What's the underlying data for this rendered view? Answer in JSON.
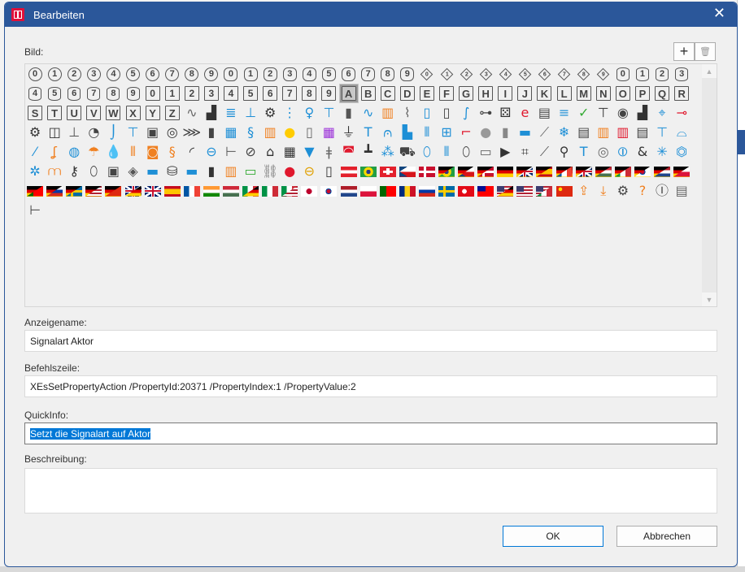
{
  "window": {
    "title": "Bearbeiten",
    "close_glyph": "✕"
  },
  "toolbar": {
    "add_glyph": "+",
    "delete_glyph": "🗑"
  },
  "picker": {
    "label": "Bild:",
    "selected": "A",
    "groups": [
      {
        "kind": "circle",
        "items": [
          "0",
          "1",
          "2",
          "3",
          "4",
          "5",
          "6",
          "7",
          "8",
          "9"
        ]
      },
      {
        "kind": "octagon",
        "items": [
          "0",
          "1",
          "2",
          "3",
          "4",
          "5",
          "6",
          "7",
          "8",
          "9"
        ]
      },
      {
        "kind": "diamond",
        "items": [
          "0",
          "1",
          "2",
          "3",
          "4",
          "5",
          "6",
          "7",
          "8",
          "9"
        ]
      },
      {
        "kind": "hexagon",
        "items": [
          "0",
          "1",
          "2",
          "3",
          "4",
          "5",
          "6",
          "7",
          "8",
          "9"
        ]
      },
      {
        "kind": "square",
        "items": [
          "0",
          "1",
          "2",
          "3",
          "4",
          "5",
          "6",
          "7",
          "8",
          "9"
        ]
      },
      {
        "kind": "letter",
        "items": [
          "A",
          "B",
          "C",
          "D",
          "E",
          "F",
          "G",
          "H",
          "I",
          "J",
          "K",
          "L",
          "M",
          "N",
          "O",
          "P",
          "Q",
          "R",
          "S",
          "T",
          "U",
          "V",
          "W",
          "X",
          "Y",
          "Z"
        ]
      },
      {
        "kind": "icon",
        "items": [
          {
            "name": "oscilloscope",
            "glyph": "∿",
            "color": "#666"
          },
          {
            "name": "factory",
            "glyph": "▟",
            "color": "#333"
          },
          {
            "name": "sensor-stack",
            "glyph": "≣",
            "color": "#1e8fd6"
          },
          {
            "name": "connector",
            "glyph": "⊥",
            "color": "#1e8fd6"
          },
          {
            "name": "gear",
            "glyph": "⚙",
            "color": "#333"
          },
          {
            "name": "stack",
            "glyph": "⋮",
            "color": "#1e8fd6"
          },
          {
            "name": "valve",
            "glyph": "♀",
            "color": "#1e8fd6"
          },
          {
            "name": "gate-valve",
            "glyph": "⊤",
            "color": "#1e8fd6"
          },
          {
            "name": "tank",
            "glyph": "▮",
            "color": "#555"
          },
          {
            "name": "waveform",
            "glyph": "∿",
            "color": "#1e8fd6"
          },
          {
            "name": "transformer",
            "glyph": "▥",
            "color": "#f08020"
          },
          {
            "name": "wireless-sensors",
            "glyph": "⌇",
            "color": "#666"
          },
          {
            "name": "filter",
            "glyph": "▯",
            "color": "#1e8fd6"
          },
          {
            "name": "tube",
            "glyph": "▯",
            "color": "#444"
          },
          {
            "name": "coil",
            "glyph": "∫",
            "color": "#1e8fd6"
          },
          {
            "name": "circuit",
            "glyph": "⊶",
            "color": "#444"
          },
          {
            "name": "dice",
            "glyph": "⚄",
            "color": "#333"
          },
          {
            "name": "e-logo",
            "glyph": "e",
            "color": "#e0182d"
          },
          {
            "name": "window-settings",
            "glyph": "▤",
            "color": "#444"
          },
          {
            "name": "database",
            "glyph": "≡",
            "color": "#1e8fd6"
          },
          {
            "name": "clipboard-check",
            "glyph": "✓",
            "color": "#3a3"
          },
          {
            "name": "lamp",
            "glyph": "⊤",
            "color": "#333"
          },
          {
            "name": "disk",
            "glyph": "◉",
            "color": "#444"
          },
          {
            "name": "factory-2",
            "glyph": "▟",
            "color": "#333"
          },
          {
            "name": "mouse-sensor",
            "glyph": "⌖",
            "color": "#1e8fd6"
          },
          {
            "name": "thermo-element",
            "glyph": "⊸",
            "color": "#e0182d"
          },
          {
            "name": "gear-small",
            "glyph": "⚙",
            "color": "#333"
          },
          {
            "name": "box-3d",
            "glyph": "◫",
            "color": "#333"
          },
          {
            "name": "piston",
            "glyph": "⊥",
            "color": "#555"
          },
          {
            "name": "gauge",
            "glyph": "◔",
            "color": "#444"
          },
          {
            "name": "probe",
            "glyph": "⌡",
            "color": "#1e8fd6"
          },
          {
            "name": "valve-blue",
            "glyph": "⊤",
            "color": "#1e8fd6"
          },
          {
            "name": "motor",
            "glyph": "▣",
            "color": "#444"
          },
          {
            "name": "reel",
            "glyph": "◎",
            "color": "#333"
          },
          {
            "name": "cable",
            "glyph": "⋙",
            "color": "#444"
          },
          {
            "name": "rod",
            "glyph": "▮",
            "color": "#444"
          },
          {
            "name": "panel",
            "glyph": "▦",
            "color": "#1e8fd6"
          },
          {
            "name": "hose",
            "glyph": "§",
            "color": "#1e8fd6"
          },
          {
            "name": "heater-element",
            "glyph": "▥",
            "color": "#f08020"
          },
          {
            "name": "bulb",
            "glyph": "●",
            "color": "#ffcc00"
          },
          {
            "name": "door",
            "glyph": "▯",
            "color": "#666"
          },
          {
            "name": "control-panel",
            "glyph": "▦",
            "color": "#9b30d9"
          },
          {
            "name": "plug",
            "glyph": "⏚",
            "color": "#333"
          },
          {
            "name": "t-profile",
            "glyph": "T",
            "color": "#1e8fd6"
          },
          {
            "name": "heater-wave",
            "glyph": "⩀",
            "color": "#1e8fd6"
          },
          {
            "name": "pump-tank",
            "glyph": "▙",
            "color": "#1e8fd6"
          },
          {
            "name": "coil-filter",
            "glyph": "⦀",
            "color": "#1e8fd6"
          },
          {
            "name": "sensors",
            "glyph": "⊞",
            "color": "#1e8fd6"
          },
          {
            "name": "valve-red",
            "glyph": "⌐",
            "color": "#e0182d"
          },
          {
            "name": "disc",
            "glyph": "●",
            "color": "#999"
          },
          {
            "name": "chimney",
            "glyph": "▮",
            "color": "#888"
          },
          {
            "name": "compressor",
            "glyph": "▬",
            "color": "#1e8fd6"
          },
          {
            "name": "ruler",
            "glyph": "⟋",
            "color": "#666"
          },
          {
            "name": "cooler",
            "glyph": "❄",
            "color": "#1e8fd6"
          },
          {
            "name": "document",
            "glyph": "▤",
            "color": "#444"
          },
          {
            "name": "heater-box",
            "glyph": "▥",
            "color": "#f08020"
          },
          {
            "name": "heater-red",
            "glyph": "▥",
            "color": "#e0182d"
          },
          {
            "name": "machine",
            "glyph": "▤",
            "color": "#444"
          },
          {
            "name": "table",
            "glyph": "⊤",
            "color": "#1e8fd6"
          },
          {
            "name": "shower",
            "glyph": "⌓",
            "color": "#1e8fd6"
          },
          {
            "name": "brush",
            "glyph": "⁄",
            "color": "#1e8fd6"
          },
          {
            "name": "crane-hook",
            "glyph": "ʆ",
            "color": "#f08020"
          },
          {
            "name": "aquarium",
            "glyph": "◍",
            "color": "#1e8fd6"
          },
          {
            "name": "umbrella-hook",
            "glyph": "☂",
            "color": "#f08020"
          },
          {
            "name": "drops",
            "glyph": "💧",
            "color": "#333"
          },
          {
            "name": "bath-heating",
            "glyph": "⫴",
            "color": "#f08020"
          },
          {
            "name": "burner",
            "glyph": "◙",
            "color": "#f08020"
          },
          {
            "name": "hose-orange",
            "glyph": "§",
            "color": "#f08020"
          },
          {
            "name": "pipe-elbow",
            "glyph": "◜",
            "color": "#333"
          },
          {
            "name": "flow-sensor",
            "glyph": "⊖",
            "color": "#1e8fd6"
          },
          {
            "name": "valve-line",
            "glyph": "⊢",
            "color": "#555"
          },
          {
            "name": "gauge-stand",
            "glyph": "⊘",
            "color": "#444"
          },
          {
            "name": "house",
            "glyph": "⌂",
            "color": "#333"
          },
          {
            "name": "grid-heater",
            "glyph": "▦",
            "color": "#333"
          },
          {
            "name": "funnel",
            "glyph": "▼",
            "color": "#1e8fd6"
          },
          {
            "name": "thermometer",
            "glyph": "ǂ",
            "color": "#666"
          },
          {
            "name": "bathtub",
            "glyph": "◚",
            "color": "#e0182d"
          },
          {
            "name": "pipe-junction",
            "glyph": "┻",
            "color": "#333"
          },
          {
            "name": "balls",
            "glyph": "⁂",
            "color": "#1e8fd6"
          },
          {
            "name": "truck",
            "glyph": "⛟",
            "color": "#444"
          },
          {
            "name": "mouse-blue",
            "glyph": "⬯",
            "color": "#1e8fd6"
          },
          {
            "name": "coil-blue",
            "glyph": "⦀",
            "color": "#1e8fd6"
          },
          {
            "name": "mouse",
            "glyph": "⬯",
            "color": "#444"
          },
          {
            "name": "battery",
            "glyph": "▭",
            "color": "#666"
          },
          {
            "name": "play-box",
            "glyph": "▶",
            "color": "#333"
          },
          {
            "name": "frame",
            "glyph": "⌗",
            "color": "#333"
          },
          {
            "name": "rail",
            "glyph": "⟋",
            "color": "#555"
          },
          {
            "name": "pin",
            "glyph": "⚲",
            "color": "#333"
          },
          {
            "name": "t-blue",
            "glyph": "T",
            "color": "#1e8fd6"
          },
          {
            "name": "target",
            "glyph": "◎",
            "color": "#666"
          },
          {
            "name": "coupler",
            "glyph": "⦶",
            "color": "#1e8fd6"
          },
          {
            "name": "logic-box",
            "glyph": "&",
            "color": "#333"
          },
          {
            "name": "sparks",
            "glyph": "✳",
            "color": "#1e8fd6"
          },
          {
            "name": "motor-blue",
            "glyph": "⏣",
            "color": "#1e8fd6"
          },
          {
            "name": "fan",
            "glyph": "✲",
            "color": "#1e8fd6"
          },
          {
            "name": "heater-coil",
            "glyph": "⩋",
            "color": "#f08020"
          },
          {
            "name": "key",
            "glyph": "⚷",
            "color": "#333"
          },
          {
            "name": "mouse-control",
            "glyph": "⬯",
            "color": "#444"
          },
          {
            "name": "multimeter",
            "glyph": "▣",
            "color": "#444"
          },
          {
            "name": "device",
            "glyph": "◈",
            "color": "#555"
          },
          {
            "name": "blowtorch",
            "glyph": "▬",
            "color": "#1e8fd6"
          },
          {
            "name": "cylinders",
            "glyph": "⛁",
            "color": "#333"
          },
          {
            "name": "pump",
            "glyph": "▬",
            "color": "#1e8fd6"
          },
          {
            "name": "tank-dark",
            "glyph": "▮",
            "color": "#333"
          },
          {
            "name": "heater-panel",
            "glyph": "▥",
            "color": "#f08020"
          },
          {
            "name": "resistor",
            "glyph": "▭",
            "color": "#3a3"
          },
          {
            "name": "chain",
            "glyph": "⛓",
            "color": "#777"
          },
          {
            "name": "red-button",
            "glyph": "●",
            "color": "#e0182d"
          },
          {
            "name": "key-switch",
            "glyph": "⊖",
            "color": "#e0a000"
          },
          {
            "name": "switch",
            "glyph": "▯",
            "color": "#333"
          }
        ]
      },
      {
        "kind": "flag",
        "items": [
          "at",
          "br",
          "ch",
          "cz",
          "dk",
          "de-br",
          "de-cz",
          "de-dk",
          "de",
          "de-gb",
          "de-es",
          "de-fr",
          "de-gb",
          "de-hu",
          "de-it",
          "de-kr",
          "de-nl",
          "de-pl",
          "de-pt",
          "de-ru",
          "de-se",
          "de-us",
          "de-cn",
          "gb-de",
          "gb",
          "es",
          "fr",
          "in",
          "hu",
          "it-de",
          "it",
          "it-us",
          "jp",
          "kr",
          "nl",
          "pl",
          "pt",
          "ro",
          "ru",
          "se",
          "tr",
          "tw",
          "us-de",
          "us",
          "us-it",
          "cn"
        ]
      },
      {
        "kind": "icon",
        "items": [
          {
            "name": "upload",
            "glyph": "⇪",
            "color": "#f08020"
          },
          {
            "name": "download",
            "glyph": "⤓",
            "color": "#f08020"
          },
          {
            "name": "gear",
            "glyph": "⚙",
            "color": "#444"
          },
          {
            "name": "help",
            "glyph": "?",
            "color": "#f08020"
          },
          {
            "name": "text-upload",
            "glyph": "Ⓘ",
            "color": "#444"
          },
          {
            "name": "pdf-file",
            "glyph": "▤",
            "color": "#666"
          },
          {
            "name": "tree",
            "glyph": "⊢",
            "color": "#444"
          }
        ]
      }
    ]
  },
  "fields": {
    "display_name": {
      "label": "Anzeigename:",
      "value": "Signalart Aktor"
    },
    "command_line": {
      "label": "Befehlszeile:",
      "value": "XEsSetPropertyAction /PropertyId:20371 /PropertyIndex:1 /PropertyValue:2"
    },
    "quickinfo": {
      "label": "QuickInfo:",
      "value": "Setzt die Signalart auf Aktor"
    },
    "description": {
      "label": "Beschreibung:",
      "value": ""
    }
  },
  "buttons": {
    "ok": "OK",
    "cancel": "Abbrechen"
  },
  "colors": {
    "titlebar": "#2b579a",
    "selection": "#0078d7",
    "app_icon": "#e0103a"
  }
}
